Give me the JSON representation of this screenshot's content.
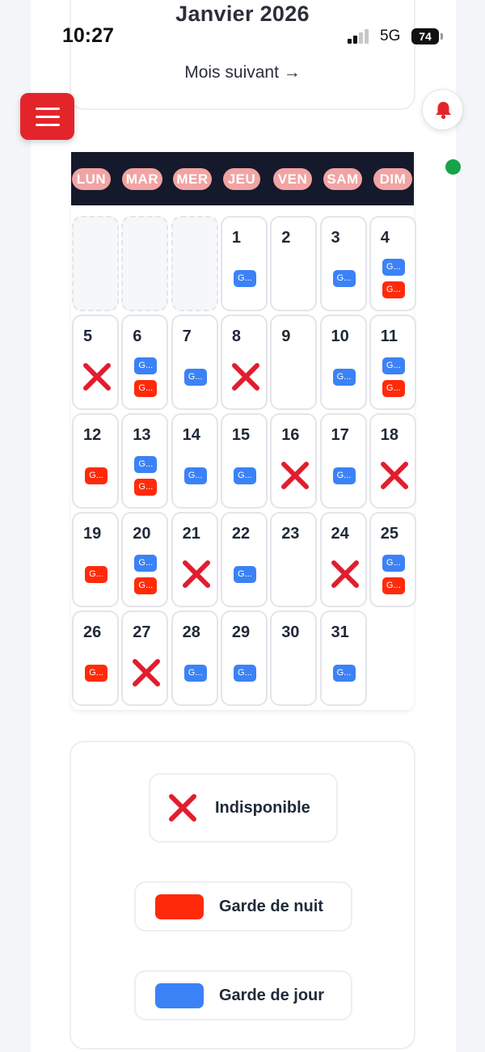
{
  "status_bar": {
    "time": "10:27",
    "network": "5G",
    "battery": "74"
  },
  "header": {
    "month_title": "Janvier 2026",
    "next_month_label": "Mois suivant →"
  },
  "icons": {
    "menu": "hamburger-icon",
    "notifications": "bell-icon",
    "unavailable": "x-cross-icon"
  },
  "colors": {
    "accent_red": "#e3252b",
    "header_bg": "#141a2b",
    "weekday_pill": "#f2a3a3",
    "day_shift": "#3b82f6",
    "night_shift": "#ff2a0a",
    "unavailable_cross": "#e11d2e",
    "online": "#16a34a"
  },
  "calendar": {
    "weekdays": [
      "LUN",
      "MAR",
      "MER",
      "JEU",
      "VEN",
      "SAM",
      "DIM"
    ],
    "shift_badge_text": "G...",
    "days": [
      {
        "n": "",
        "empty": true
      },
      {
        "n": "",
        "empty": true
      },
      {
        "n": "",
        "empty": true
      },
      {
        "n": "1",
        "day": true
      },
      {
        "n": "2"
      },
      {
        "n": "3",
        "day": true
      },
      {
        "n": "4",
        "day": true,
        "night": true
      },
      {
        "n": "5",
        "unavailable": true
      },
      {
        "n": "6",
        "day": true,
        "night": true
      },
      {
        "n": "7",
        "day": true
      },
      {
        "n": "8",
        "unavailable": true
      },
      {
        "n": "9"
      },
      {
        "n": "10",
        "day": true
      },
      {
        "n": "11",
        "day": true,
        "night": true
      },
      {
        "n": "12",
        "night": true
      },
      {
        "n": "13",
        "day": true,
        "night": true
      },
      {
        "n": "14",
        "day": true
      },
      {
        "n": "15",
        "day": true
      },
      {
        "n": "16",
        "unavailable": true
      },
      {
        "n": "17",
        "day": true
      },
      {
        "n": "18",
        "unavailable": true
      },
      {
        "n": "19",
        "night": true
      },
      {
        "n": "20",
        "day": true,
        "night": true
      },
      {
        "n": "21",
        "unavailable": true
      },
      {
        "n": "22",
        "day": true
      },
      {
        "n": "23"
      },
      {
        "n": "24",
        "unavailable": true
      },
      {
        "n": "25",
        "day": true,
        "night": true
      },
      {
        "n": "26",
        "night": true
      },
      {
        "n": "27",
        "unavailable": true
      },
      {
        "n": "28",
        "day": true
      },
      {
        "n": "29",
        "day": true
      },
      {
        "n": "30"
      },
      {
        "n": "31",
        "day": true
      }
    ]
  },
  "legend": {
    "unavailable": "Indisponible",
    "night_shift": "Garde de nuit",
    "day_shift": "Garde de jour"
  }
}
